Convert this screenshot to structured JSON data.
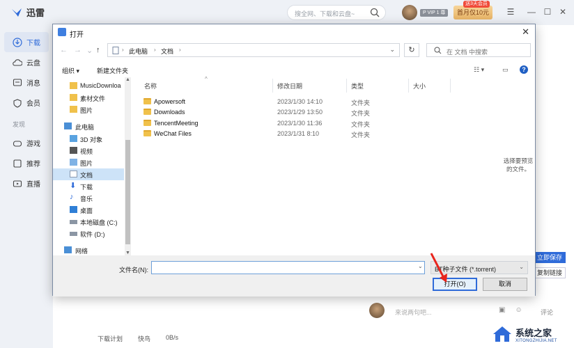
{
  "app": {
    "title": "迅雷",
    "search_placeholder": "搜全网、下载和云盘~",
    "vip_badge": "P VIP 1 尊",
    "promo": "首月仅10元",
    "promo_tag": "送3天会员",
    "sidebar": {
      "items": [
        {
          "label": "下载",
          "icon": "download-icon",
          "active": true
        },
        {
          "label": "云盘",
          "icon": "cloud-icon"
        },
        {
          "label": "消息",
          "icon": "message-icon"
        },
        {
          "label": "会员",
          "icon": "member-icon"
        }
      ],
      "group_label": "发现",
      "discover": [
        {
          "label": "游戏",
          "icon": "game-icon"
        },
        {
          "label": "推荐",
          "icon": "recommend-icon"
        },
        {
          "label": "直播",
          "icon": "live-icon"
        }
      ]
    },
    "bottom": {
      "plan": "下载计划",
      "fast": "快鸟",
      "speed": "0B/s"
    },
    "comment": {
      "placeholder": "来说两句吧...",
      "label": "评论"
    },
    "right_buttons": {
      "save": "立即保存",
      "copy": "复制链接"
    },
    "watermark": {
      "title": "系统之家",
      "sub": "XITONGZHIJIA.NET"
    }
  },
  "dialog": {
    "title": "打开",
    "close": "✕",
    "address": {
      "crumbs": [
        "此电脑",
        "文档"
      ]
    },
    "search_placeholder": "在 文档 中搜索",
    "toolbar": {
      "organize": "组织 ▾",
      "new_folder": "新建文件夹"
    },
    "nav_items": [
      {
        "label": "MusicDownloa",
        "icon": "folder-icon",
        "indent": 1
      },
      {
        "label": "素材文件",
        "icon": "folder-icon",
        "indent": 1
      },
      {
        "label": "图片",
        "icon": "folder-icon",
        "indent": 1
      },
      {
        "label": "此电脑",
        "icon": "computer-icon",
        "indent": 0
      },
      {
        "label": "3D 对象",
        "icon": "cube-icon",
        "indent": 1
      },
      {
        "label": "视频",
        "icon": "video-icon",
        "indent": 1
      },
      {
        "label": "图片",
        "icon": "pictures-icon",
        "indent": 1
      },
      {
        "label": "文档",
        "icon": "documents-icon",
        "indent": 1,
        "selected": true
      },
      {
        "label": "下载",
        "icon": "download-arrow-icon",
        "indent": 1
      },
      {
        "label": "音乐",
        "icon": "music-icon",
        "indent": 1
      },
      {
        "label": "桌面",
        "icon": "desktop-icon",
        "indent": 1
      },
      {
        "label": "本地磁盘 (C:)",
        "icon": "drive-icon",
        "indent": 1
      },
      {
        "label": "软件 (D:)",
        "icon": "drive-icon",
        "indent": 1
      },
      {
        "label": "网络",
        "icon": "network-icon",
        "indent": 0
      }
    ],
    "columns": {
      "name": "名称",
      "date": "修改日期",
      "type": "类型",
      "size": "大小"
    },
    "files": [
      {
        "name": "Apowersoft",
        "date": "2023/1/30 14:10",
        "type": "文件夹"
      },
      {
        "name": "Downloads",
        "date": "2023/1/29 13:50",
        "type": "文件夹"
      },
      {
        "name": "TencentMeeting",
        "date": "2023/1/30 11:36",
        "type": "文件夹"
      },
      {
        "name": "WeChat Files",
        "date": "2023/1/31 8:10",
        "type": "文件夹"
      }
    ],
    "preview_hint": "选择要预览的文件。",
    "filename_label": "文件名(N):",
    "filename_value": "",
    "filetype": "BT种子文件 (*.torrent)",
    "open_btn": "打开(O)",
    "cancel_btn": "取消"
  }
}
